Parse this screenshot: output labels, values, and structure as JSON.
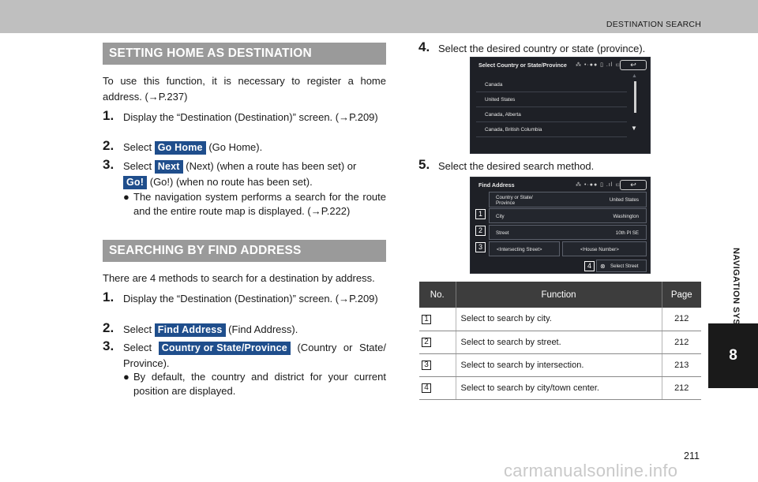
{
  "header": {
    "section_title": "DESTINATION SEARCH"
  },
  "side_tab": {
    "label": "NAVIGATION SYSTEM",
    "chapter": "8"
  },
  "left": {
    "home_banner": "SETTING HOME AS DESTINATION",
    "home_intro": "To use this function, it is necessary to register a home address. (→P.237)",
    "home_steps": [
      {
        "num": "1.",
        "pre": "Display the “Destination (Destination)” screen. (→P.209)"
      },
      {
        "num": "2.",
        "pre": "Select ",
        "btn": "Go Home",
        "post": " (Go Home)."
      },
      {
        "num": "3.",
        "pre": "Select ",
        "btn": "Next",
        "post": " (Next) (when a route has been set) or",
        "btn2": "Go!",
        "post2": " (Go!) (when no route has been set)."
      }
    ],
    "home_bullet": "The navigation system performs a search for the route and the entire route map is displayed. (→P.222)",
    "address_banner": "SEARCHING BY FIND ADDRESS",
    "address_intro": "There are 4 methods to search for a destination by address.",
    "address_steps": [
      {
        "num": "1.",
        "pre": "Display the “Destination (Destination)” screen. (→P.209)"
      },
      {
        "num": "2.",
        "pre": "Select ",
        "btn": "Find Address",
        "post": " (Find Address)."
      },
      {
        "num": "3.",
        "pre": "Select ",
        "btn": "Country or State/Province",
        "post": " (Country or State/ Province)."
      }
    ],
    "address_bullet": "By default, the country and district for your current position are displayed.",
    "bullet_symbol": "●"
  },
  "right": {
    "step4": {
      "num": "4.",
      "text": "Select the desired country or state (province)."
    },
    "step5": {
      "num": "5.",
      "text": "Select the desired search method."
    },
    "screen1": {
      "title": "Select Country or State/Province",
      "status": "⁂ •·●● ▯ .ıl ▭",
      "back": "↩",
      "items": [
        "Canada",
        "United States",
        "Canada, Alberta",
        "Canada, British Columbia"
      ],
      "scroll_up": "▲",
      "scroll_down": "▼"
    },
    "screen2": {
      "title": "Find Address",
      "status": "⁂ •·●● ▯ .ıl ▭",
      "back": "↩",
      "rows": [
        {
          "left": "Country or State/ Province",
          "right": "United States"
        },
        {
          "left": "City",
          "right": "Washington",
          "tag": "1"
        },
        {
          "left": "Street",
          "right": "10th Pl SE",
          "tag": "2"
        },
        {
          "left": "<Intersecting Street>",
          "right": "<House Number>",
          "tag": "3"
        }
      ],
      "select_street": "Select Street",
      "select_tag": "4",
      "select_icon": "⊗"
    },
    "table": {
      "headers": [
        "No.",
        "Function",
        "Page"
      ],
      "rows": [
        {
          "no": "1",
          "fn": "Select to search by city.",
          "page": "212"
        },
        {
          "no": "2",
          "fn": "Select to search by street.",
          "page": "212"
        },
        {
          "no": "3",
          "fn": "Select to search by intersection.",
          "page": "213"
        },
        {
          "no": "4",
          "fn": "Select to search by city/town center.",
          "page": "212"
        }
      ]
    }
  },
  "footer": {
    "page_number": "211",
    "watermark": "carmanualsonline.info"
  }
}
